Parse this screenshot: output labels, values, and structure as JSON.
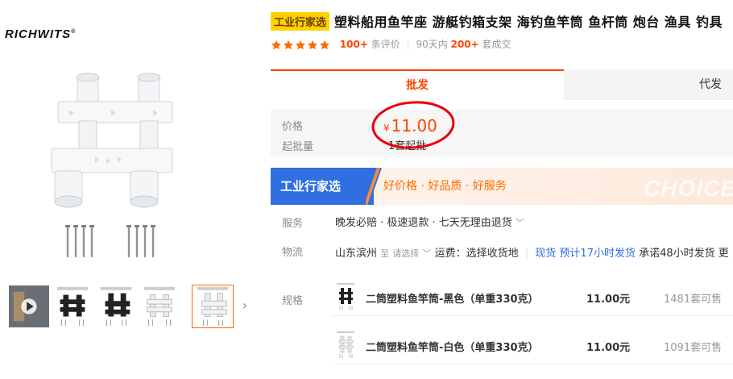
{
  "brand": {
    "name": "RICHWITS",
    "mark": "®"
  },
  "gallery": {
    "thumbnails": [
      {
        "icon": "play-icon"
      },
      {
        "icon": "rod-holder-black"
      },
      {
        "icon": "rod-holder-black-angle"
      },
      {
        "icon": "rod-holder-white"
      },
      {
        "icon": "rod-holder-white-angle"
      }
    ],
    "next_arrow": "›"
  },
  "product": {
    "tag": "工业行家选",
    "title": "塑料船用鱼竿座 游艇钓箱支架 海钓鱼竿筒 鱼杆筒 炮台 渔具 钓具",
    "rating_stars": 5,
    "reviews_count": "100+",
    "reviews_label": "条评价",
    "sales_period": "90天内",
    "sales_count": "200+",
    "sales_label": "套成交"
  },
  "tabs": {
    "wholesale": "批发",
    "agent": "代发"
  },
  "price": {
    "label": "价格",
    "currency": "¥",
    "amount": "11.00",
    "moq_label": "起批量",
    "moq_value": "1套起批"
  },
  "banner": {
    "title": "工业行家选",
    "slogan": "好价格 · 好品质 · 好服务",
    "watermark": "CHOICE"
  },
  "service": {
    "label": "服务",
    "text": "晚发必赔 · 极速退款 · 七天无理由退货"
  },
  "logistics": {
    "label": "物流",
    "origin": "山东滨州",
    "to": "至",
    "select_placeholder": "请选择",
    "shipping_fee": "运费：选择收货地",
    "stock_status": "现货",
    "ship_time": "预计17小时发货",
    "promise": "承诺48小时发货",
    "more": "更"
  },
  "specs": {
    "label": "规格",
    "items": [
      {
        "name": "二筒塑料鱼竿筒-黑色（单重330克）",
        "price": "11.00元",
        "stock": "1481套可售",
        "color": "#222222"
      },
      {
        "name": "二筒塑料鱼竿筒-白色（单重330克）",
        "price": "11.00元",
        "stock": "1091套可售",
        "color": "#d8d8d8"
      }
    ]
  },
  "colors": {
    "accent": "#ff4400",
    "tag_bg": "#ffd100",
    "banner_blue": "#2f6fe0",
    "circle": "#e8000b"
  }
}
